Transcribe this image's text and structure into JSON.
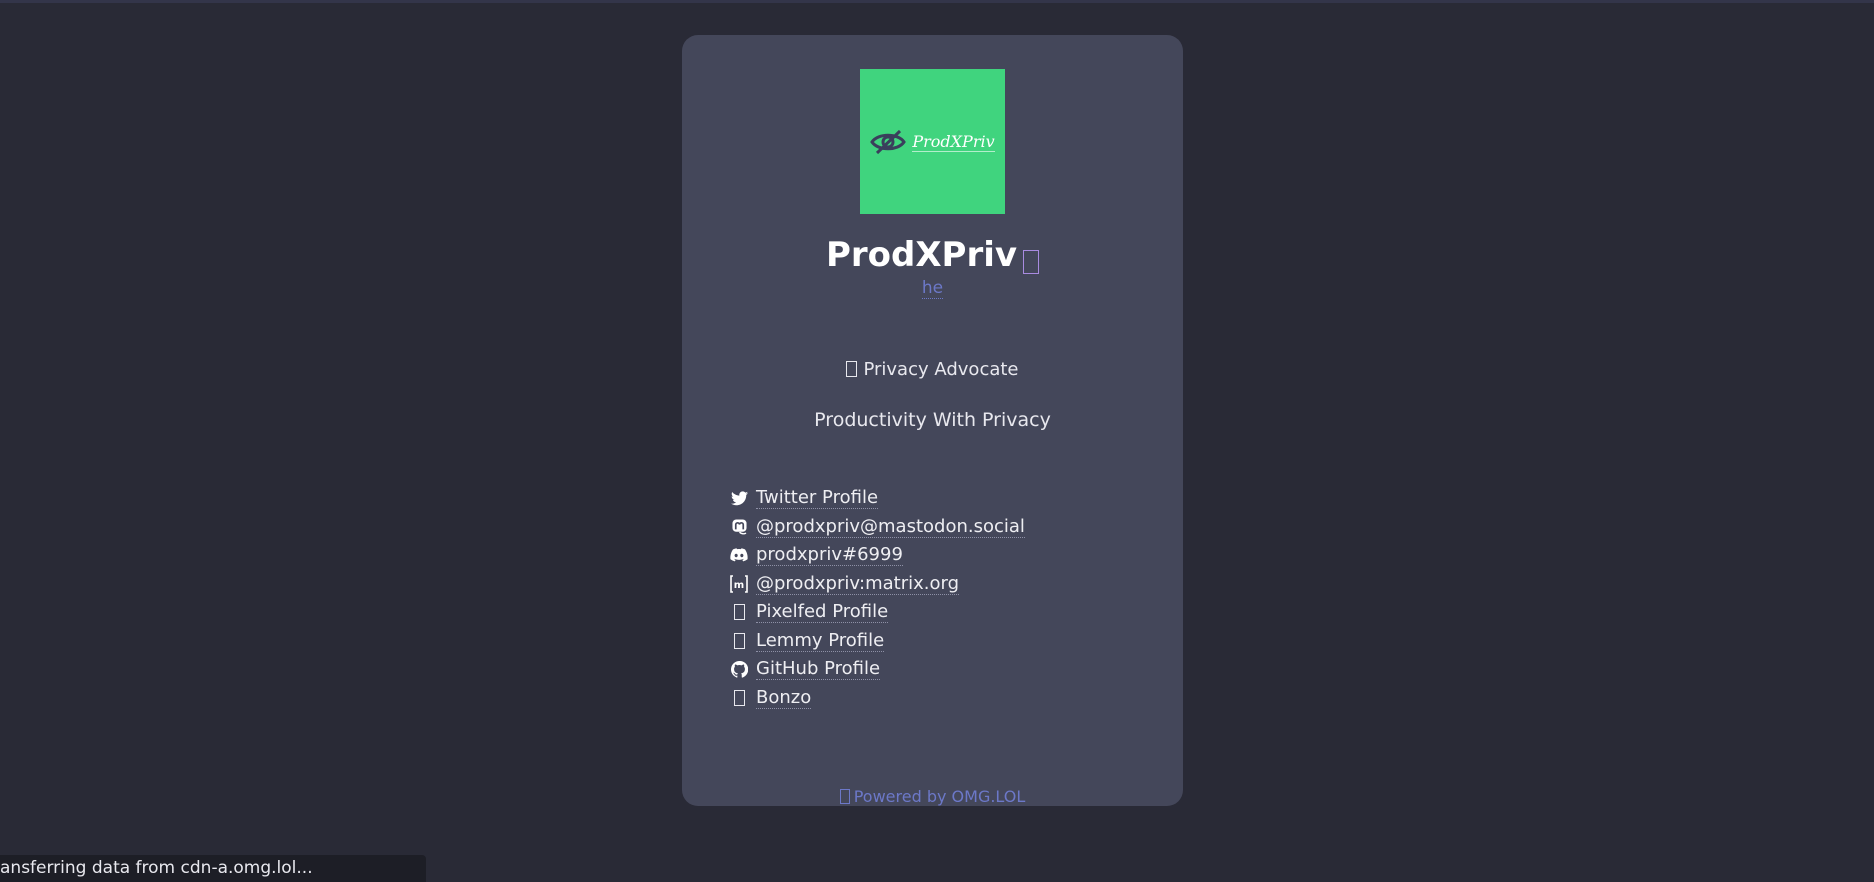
{
  "profile": {
    "name": "ProdXPriv",
    "logo_text": "ProdXPriv",
    "pronoun": "he",
    "occupation": "Privacy Advocate",
    "tagline": "Productivity With Privacy"
  },
  "links": [
    {
      "icon": "twitter-icon",
      "label": "Twitter Profile"
    },
    {
      "icon": "mastodon-icon",
      "label": "@prodxpriv@mastodon.social"
    },
    {
      "icon": "discord-icon",
      "label": "prodxpriv#6999"
    },
    {
      "icon": "matrix-icon",
      "label": "@prodxpriv:matrix.org"
    },
    {
      "icon": "missing-glyph-icon",
      "label": "Pixelfed Profile"
    },
    {
      "icon": "missing-glyph-icon",
      "label": "Lemmy Profile"
    },
    {
      "icon": "github-icon",
      "label": "GitHub Profile"
    },
    {
      "icon": "missing-glyph-icon",
      "label": "Bonzo"
    }
  ],
  "footer": {
    "label": "Powered by OMG.LOL"
  },
  "status_bar": {
    "text": "ansferring data from cdn-a.omg.lol..."
  },
  "colors": {
    "background": "#292a36",
    "card": "#44475a",
    "avatar": "#40d47e",
    "link_accent": "#6c78c8"
  }
}
